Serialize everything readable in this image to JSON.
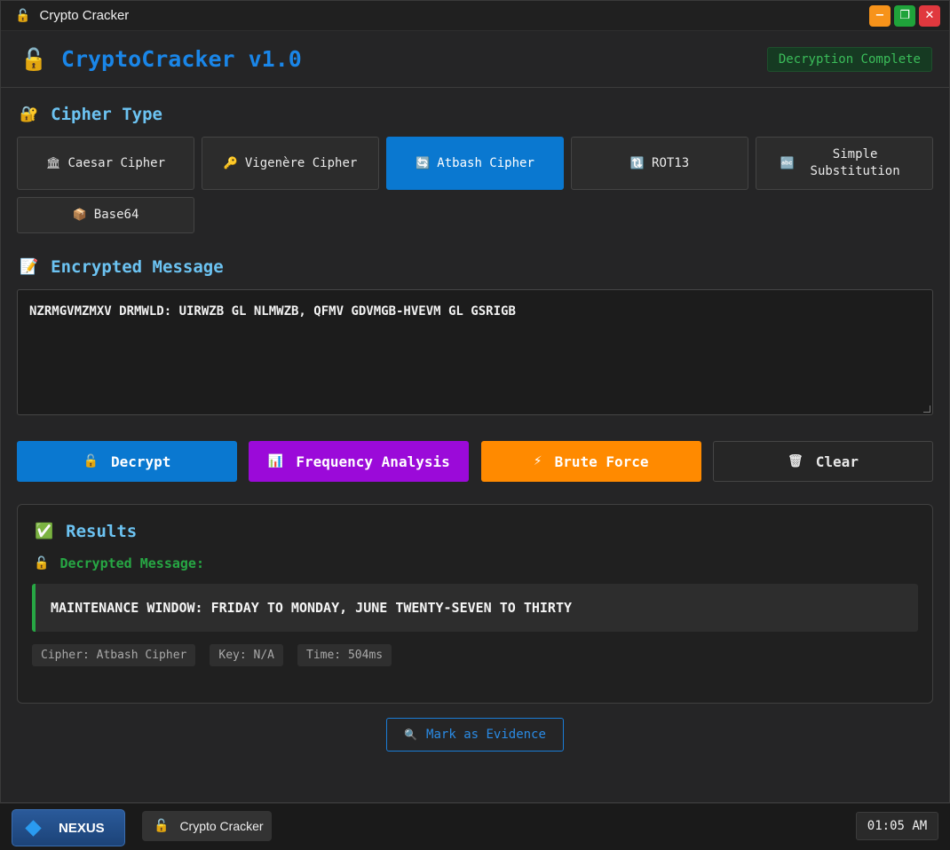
{
  "window": {
    "title": "Crypto Cracker",
    "icon": "unlock-icon",
    "controls": {
      "minimize": "−",
      "maximize": "❐",
      "close": "✕"
    }
  },
  "header": {
    "title": "CryptoCracker v1.0",
    "status": "Decryption Complete"
  },
  "cipher_section": {
    "title": "Cipher Type",
    "options": [
      {
        "label": "Caesar Cipher",
        "icon": "🏛",
        "active": false
      },
      {
        "label": "Vigenère Cipher",
        "icon": "🔑",
        "active": false
      },
      {
        "label": "Atbash Cipher",
        "icon": "🔄",
        "active": true
      },
      {
        "label": "ROT13",
        "icon": "🔃",
        "active": false
      },
      {
        "label": "Simple Substitution",
        "icon": "🔤",
        "active": false
      },
      {
        "label": "Base64",
        "icon": "📦",
        "active": false
      }
    ]
  },
  "encrypted_section": {
    "title": "Encrypted Message",
    "value": "NZRMGVMZMXV DRMWLD: UIRWZB GL NLMWZB, QFMV GDVMGB-HVEVM GL GSRIGB"
  },
  "actions": {
    "decrypt": "Decrypt",
    "frequency": "Frequency Analysis",
    "brute": "Brute Force",
    "clear": "Clear"
  },
  "results": {
    "title": "Results",
    "decrypted_label": "Decrypted Message:",
    "decrypted_value": "MAINTENANCE WINDOW: FRIDAY TO MONDAY, JUNE TWENTY-SEVEN TO THIRTY",
    "meta": {
      "cipher": "Cipher: Atbash Cipher",
      "key": "Key: N/A",
      "time": "Time: 504ms"
    }
  },
  "evidence_button": "Mark as Evidence",
  "taskbar": {
    "start_label": "NEXUS",
    "task_label": "Crypto Cracker",
    "clock": "01:05 AM"
  },
  "colors": {
    "accent": "#0a78d0",
    "success": "#27a744",
    "purple": "#9b0ad9",
    "orange": "#ff8a00"
  }
}
